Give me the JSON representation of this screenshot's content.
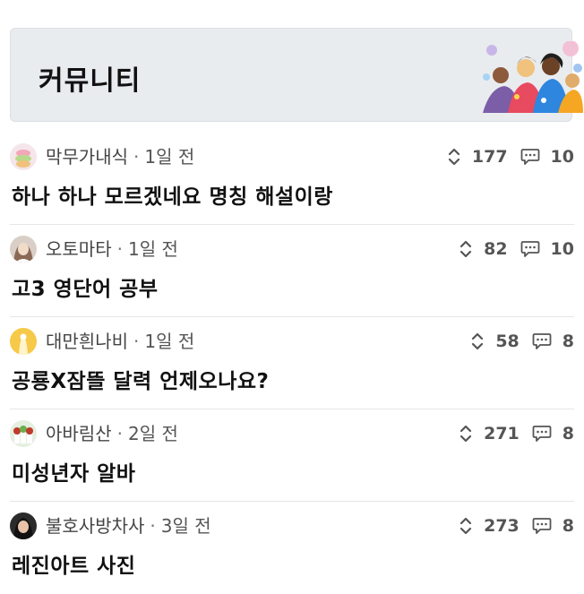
{
  "banner": {
    "title": "커뮤니티"
  },
  "posts": [
    {
      "author": "막무가내식",
      "time": "1일 전",
      "title": "하나 하나 모르겠네요 명칭 해설이랑",
      "votes": "177",
      "comments": "10"
    },
    {
      "author": "오토마타",
      "time": "1일 전",
      "title": "고3 영단어 공부",
      "votes": "82",
      "comments": "10"
    },
    {
      "author": "대만흰나비",
      "time": "1일 전",
      "title": "공룡X잠뜰 달력 언제오나요?",
      "votes": "58",
      "comments": "8"
    },
    {
      "author": "아바림산",
      "time": "2일 전",
      "title": "미성년자 알바",
      "votes": "271",
      "comments": "8"
    },
    {
      "author": "불호사방차사",
      "time": "3일 전",
      "title": "레진아트 사진",
      "votes": "273",
      "comments": "8"
    }
  ],
  "icons": {
    "vote": "updown-chevron-icon",
    "comment": "speech-bubble-icon"
  },
  "colors": {
    "banner_bg": "#e9ecef",
    "divider": "#e3e5e8",
    "meta_text": "#555555"
  }
}
